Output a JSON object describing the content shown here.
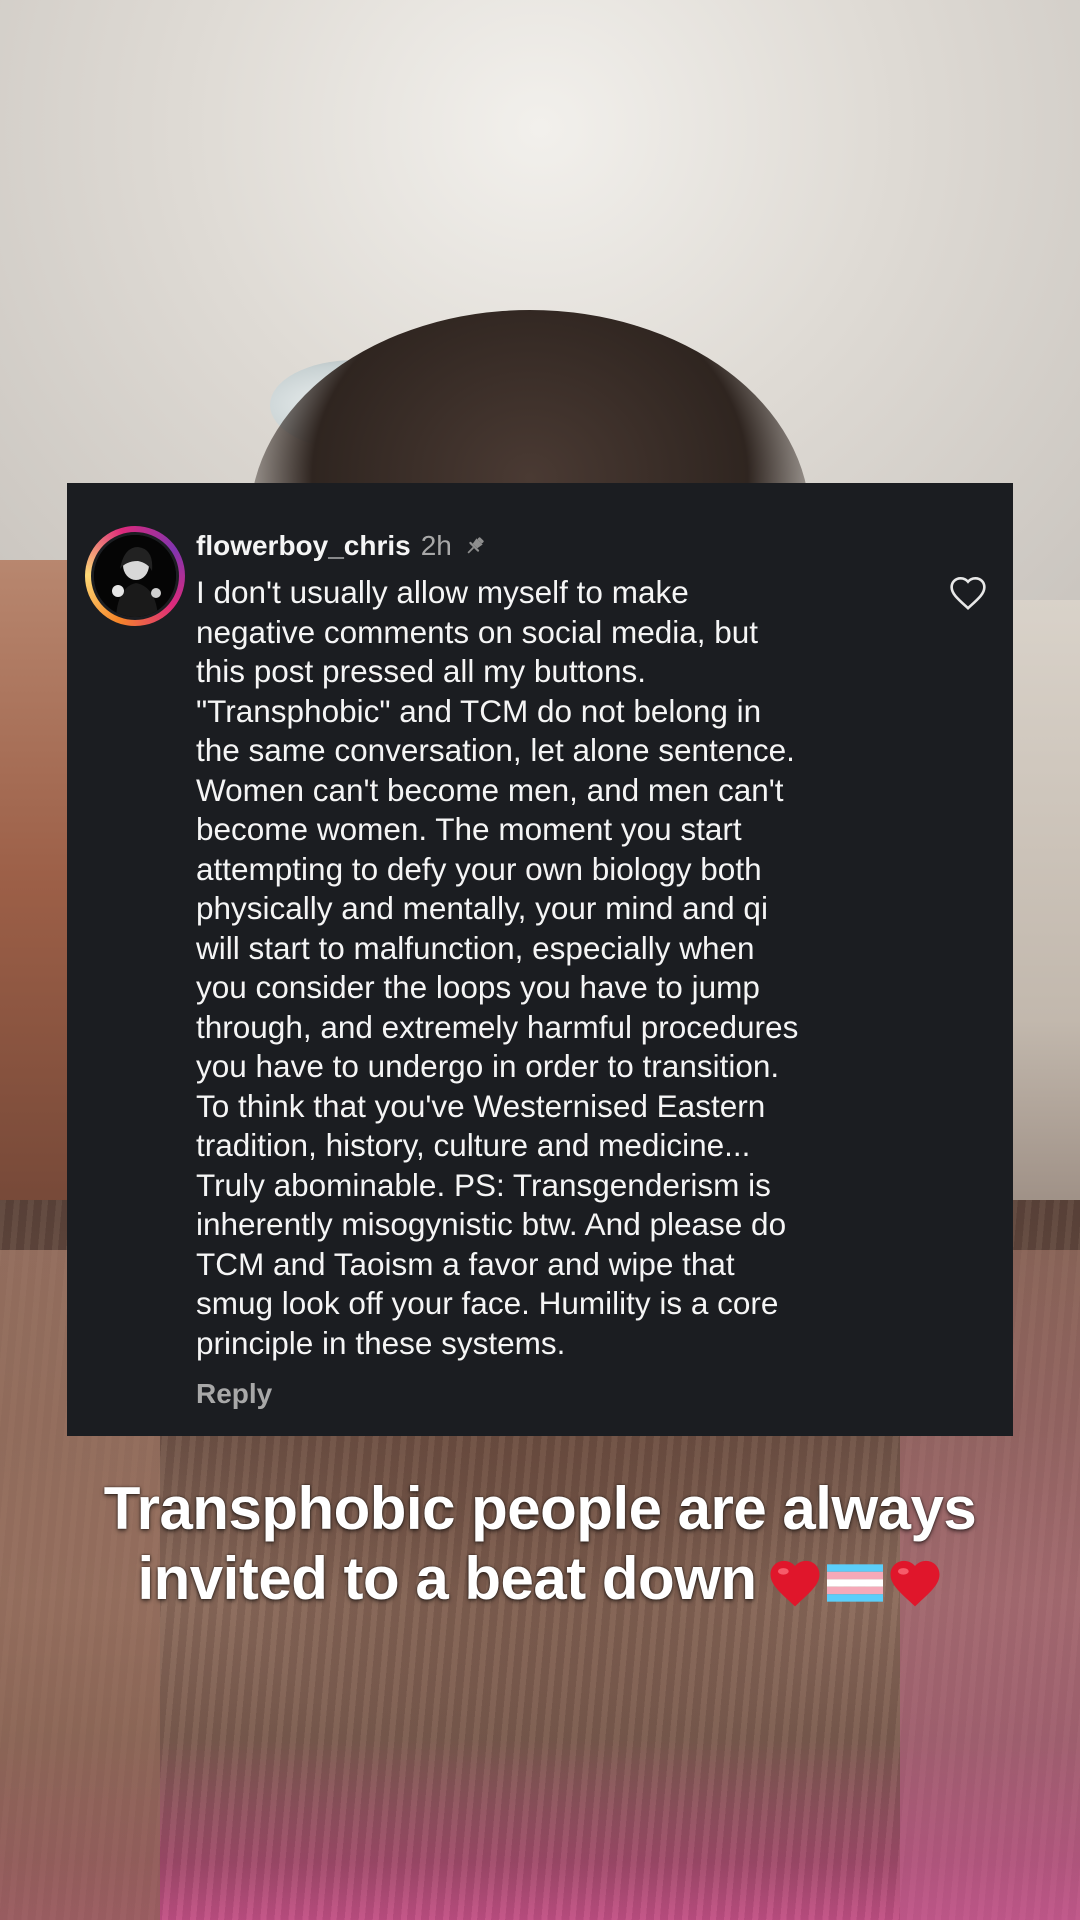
{
  "comment": {
    "username": "flowerboy_chris",
    "timestamp": "2h",
    "pinned": true,
    "text_lines": [
      "I don't usually allow myself to make",
      "negative comments on social media, but",
      "this post pressed all my buttons.",
      "\"Transphobic\" and TCM do not belong in",
      "the same conversation, let alone sentence.",
      "Women can't become men, and men can't",
      "become women. The moment you start",
      "attempting to defy your own biology both",
      "physically and mentally, your mind and qi",
      "will start to malfunction, especially when",
      "you consider the loops you have to jump",
      "through, and extremely harmful procedures",
      "you have to undergo in order to transition.",
      "To think that you've Westernised Eastern",
      "tradition, history, culture and medicine...",
      "Truly abominable. PS: Transgenderism is",
      "inherently misogynistic btw. And please do",
      "TCM and Taoism a favor and wipe that",
      "smug look off your face. Humility is a core",
      "principle in these systems."
    ],
    "reply_label": "Reply",
    "icons": {
      "avatar": "profile-avatar",
      "pin": "pin-icon",
      "like": "heart-outline-icon"
    }
  },
  "caption": {
    "line1": "Transphobic people are always",
    "line2": "invited to a beat down",
    "emojis": [
      "red-heart-emoji",
      "transgender-flag-emoji",
      "red-heart-emoji"
    ]
  },
  "colors": {
    "card_bg": "#1b1d21",
    "primary_text": "#f5f5f5",
    "secondary_text": "#a8a8a8",
    "heart_red": "#e0162b",
    "flag_blue": "#5bcefa",
    "flag_pink": "#f5a9b8",
    "flag_white": "#ffffff"
  }
}
